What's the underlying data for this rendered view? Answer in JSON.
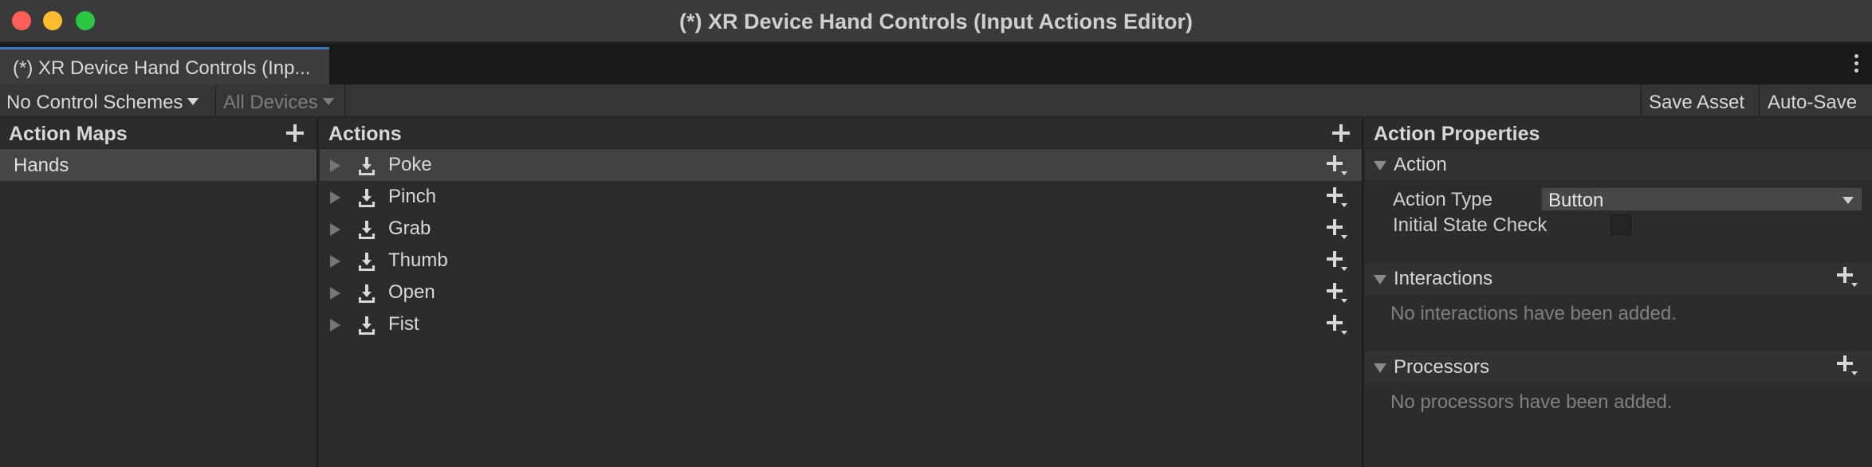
{
  "window": {
    "title": "(*) XR Device Hand Controls (Input Actions Editor)"
  },
  "tab": {
    "label": "(*) XR Device Hand Controls (Inp..."
  },
  "toolbar": {
    "control_schemes": "No Control Schemes",
    "devices": "All Devices",
    "save_asset": "Save Asset",
    "auto_save": "Auto-Save"
  },
  "action_maps": {
    "header": "Action Maps",
    "items": [
      {
        "label": "Hands",
        "selected": true
      }
    ]
  },
  "actions": {
    "header": "Actions",
    "items": [
      {
        "label": "Poke",
        "selected": true
      },
      {
        "label": "Pinch"
      },
      {
        "label": "Grab"
      },
      {
        "label": "Thumb"
      },
      {
        "label": "Open"
      },
      {
        "label": "Fist"
      }
    ]
  },
  "properties": {
    "header": "Action Properties",
    "action_section": "Action",
    "action_type_label": "Action Type",
    "action_type_value": "Button",
    "initial_state_label": "Initial State Check",
    "initial_state_checked": false,
    "interactions_section": "Interactions",
    "interactions_empty": "No interactions have been added.",
    "processors_section": "Processors",
    "processors_empty": "No processors have been added."
  },
  "colors": {
    "tab_accent": "#3a79bb",
    "traffic_close": "#ff5f57",
    "traffic_minimize": "#febc2e",
    "traffic_maximize": "#28c840"
  },
  "icons": {
    "action_icon": "download-icon",
    "add_icon": "plus-icon",
    "add_menu_icon": "plus-dropdown-icon"
  }
}
